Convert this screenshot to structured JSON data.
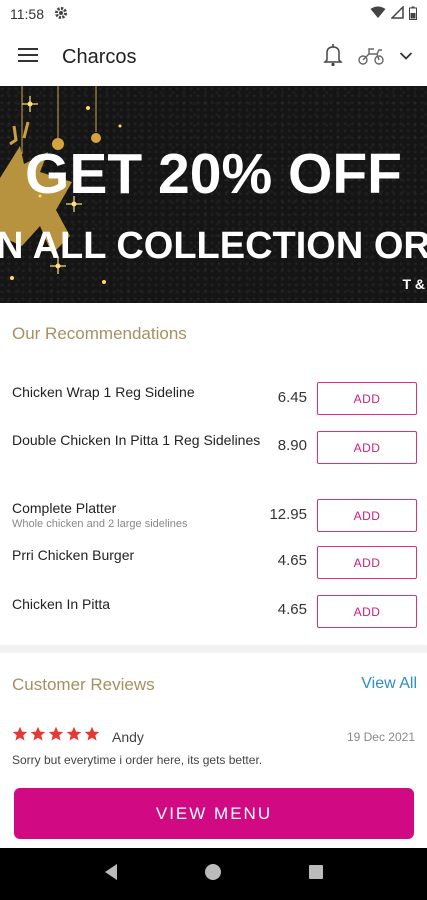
{
  "status_bar": {
    "time": "11:58"
  },
  "app_bar": {
    "title": "Charcos"
  },
  "banner": {
    "line1": "GET 20% OFF",
    "line2": "N ALL COLLECTION ORDE",
    "tc": "T &"
  },
  "recommendations": {
    "title": "Our Recommendations",
    "add_label": "ADD",
    "items": [
      {
        "name": "Chicken Wrap 1 Reg Sideline",
        "desc": "",
        "price": "6.45"
      },
      {
        "name": "Double Chicken In Pitta 1 Reg Sidelines",
        "desc": "",
        "price": "8.90"
      },
      {
        "name": "Complete Platter",
        "desc": "Whole chicken and 2 large sidelines",
        "price": "12.95"
      },
      {
        "name": "Prri Chicken Burger",
        "desc": "",
        "price": "4.65"
      },
      {
        "name": "Chicken In Pitta",
        "desc": "",
        "price": "4.65"
      }
    ]
  },
  "reviews": {
    "title": "Customer Reviews",
    "view_all": "View All",
    "items": [
      {
        "rating": 5,
        "name": "Andy",
        "date": "19 Dec 2021",
        "text": "Sorry but everytime i order here, its gets better."
      }
    ]
  },
  "view_menu": "VIEW MENU",
  "colors": {
    "accent": "#d10983",
    "gold": "#a88f63",
    "link": "#2b90c2",
    "star": "#e53935"
  }
}
